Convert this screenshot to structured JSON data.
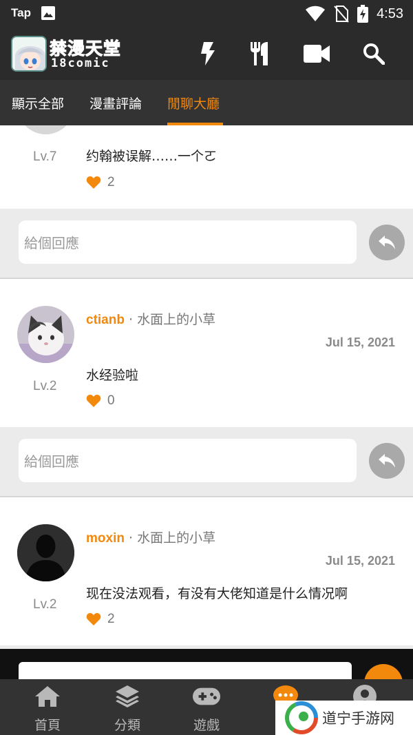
{
  "status": {
    "left_label": "Tap",
    "time": "4:53",
    "icons": [
      "image-icon",
      "wifi-icon",
      "no-sim-icon",
      "battery-charging-icon"
    ]
  },
  "appbar": {
    "logo_text": "禁漫天堂",
    "logo_sub": "18comic",
    "actions": [
      "flash-icon",
      "restaurant-icon",
      "video-icon",
      "search-icon"
    ]
  },
  "tabs": [
    {
      "label": "顯示全部"
    },
    {
      "label": "漫畫評論"
    },
    {
      "label": "閒聊大廳",
      "active": true
    }
  ],
  "comments": [
    {
      "level": "Lv.7",
      "message": "约翰被误解……一个ㄛ",
      "likes": "2",
      "reply_placeholder": "給個回應"
    },
    {
      "username": "ctianb",
      "separator": "·",
      "group": "水面上的小草",
      "date": "Jul 15, 2021",
      "level": "Lv.2",
      "message": "水经验啦",
      "likes": "0",
      "reply_placeholder": "給個回應"
    },
    {
      "username": "moxin",
      "separator": "·",
      "group": "水面上的小草",
      "date": "Jul 15, 2021",
      "level": "Lv.2",
      "message": "现在没法观看，有没有大佬知道是什么情况啊",
      "likes": "2"
    }
  ],
  "bottom_nav": [
    {
      "label": "首頁",
      "icon": "home-icon"
    },
    {
      "label": "分類",
      "icon": "layers-icon"
    },
    {
      "label": "遊戲",
      "icon": "gamepad-icon"
    },
    {
      "label": "討",
      "icon": "chat-icon",
      "active": true
    },
    {
      "label": "",
      "icon": "account-icon"
    }
  ],
  "watermark": {
    "text": "道宁手游网"
  },
  "colors": {
    "accent": "#f2880c",
    "bar": "#333333",
    "status": "#2b2b2b",
    "bg": "#ebebeb"
  }
}
